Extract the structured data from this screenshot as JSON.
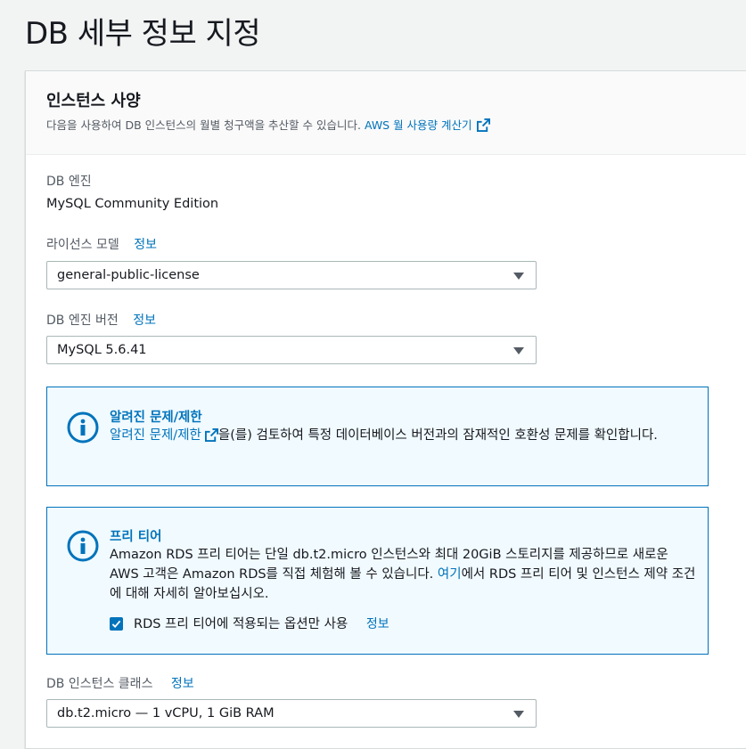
{
  "page": {
    "title": "DB 세부 정보 지정"
  },
  "panel": {
    "title": "인스턴스 사양",
    "description": "다음을 사용하여 DB 인스턴스의 월별 청구액을 추산할 수 있습니다.",
    "calculator_link": "AWS 월 사용량 계산기"
  },
  "engine": {
    "label": "DB 엔진",
    "value": "MySQL Community Edition"
  },
  "license": {
    "label": "라이선스 모델",
    "info": "정보",
    "value": "general-public-license"
  },
  "engine_version": {
    "label": "DB 엔진 버전",
    "info": "정보",
    "value": "MySQL 5.6.41"
  },
  "known_issues": {
    "title": "알려진 문제/제한",
    "link": "알려진 문제/제한",
    "text": "을(를) 검토하여 특정 데이터베이스 버전과의 잠재적인 호환성 문제를 확인합니다."
  },
  "free_tier": {
    "title": "프리 티어",
    "text_before": "Amazon RDS 프리 티어는 단일 db.t2.micro 인스턴스와 최대 20GiB 스토리지를 제공하므로 새로운 AWS 고객은 Amazon RDS를 직접 체험해 볼 수 있습니다.",
    "link": "여기",
    "text_after": "에서 RDS 프리 티어 및 인스턴스 제약 조건에 대해 자세히 알아보십시오.",
    "checkbox_label": "RDS 프리 티어에 적용되는 옵션만 사용",
    "checkbox_checked": true,
    "info": "정보"
  },
  "instance_class": {
    "label": "DB 인스턴스 클래스",
    "info": "정보",
    "value": "db.t2.micro — 1 vCPU, 1 GiB RAM"
  },
  "colors": {
    "link": "#0073bb",
    "alert_bg": "#f1faff",
    "alert_border": "#0073bb"
  },
  "icons": {
    "external": "external-link-icon",
    "info": "info-circle-icon",
    "caret": "caret-down-icon",
    "check": "check-icon"
  }
}
